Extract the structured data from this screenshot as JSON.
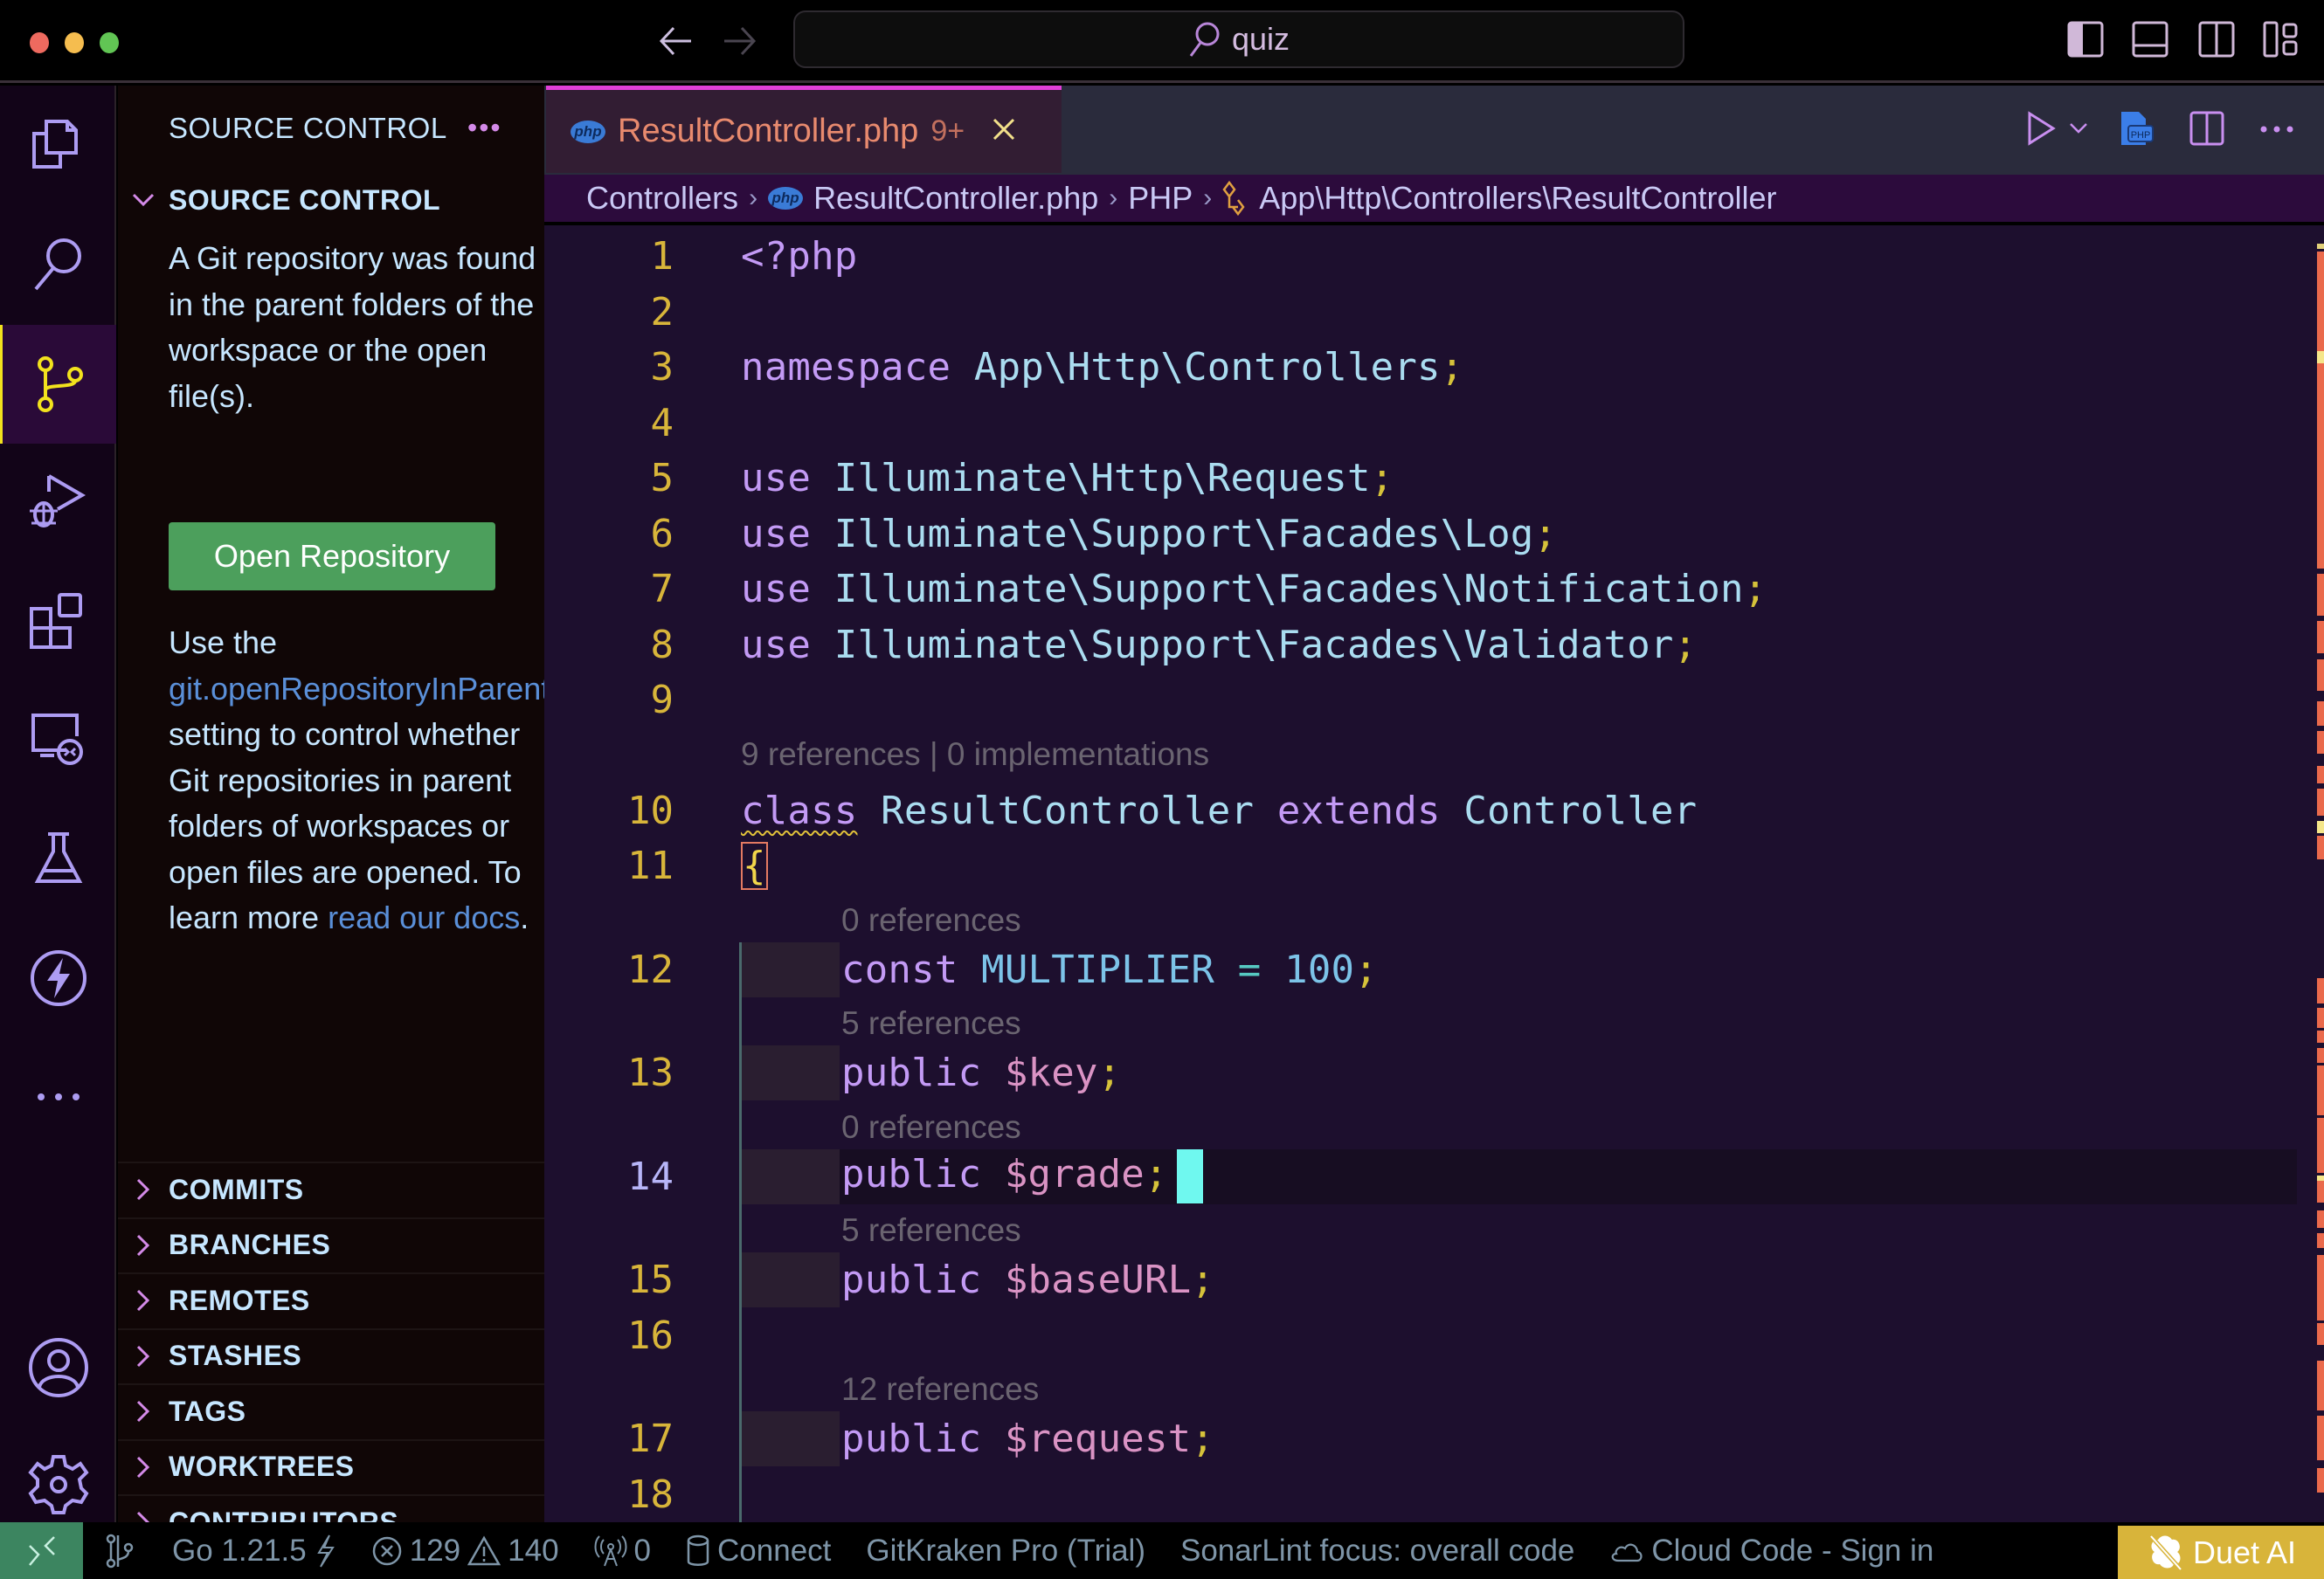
{
  "titlebar": {
    "search_text": "quiz",
    "traffic_lights": {
      "close": "#ee6a5f",
      "minimize": "#f5bd4f",
      "maximize": "#61c554"
    }
  },
  "activity_bar": {
    "items": [
      {
        "name": "explorer",
        "icon": "files-icon"
      },
      {
        "name": "search",
        "icon": "search-icon"
      },
      {
        "name": "source-control",
        "icon": "source-control-icon",
        "active": true
      },
      {
        "name": "run-debug",
        "icon": "run-debug-icon"
      },
      {
        "name": "extensions",
        "icon": "extensions-icon"
      },
      {
        "name": "remote-explorer",
        "icon": "remote-explorer-icon"
      },
      {
        "name": "testing",
        "icon": "flask-icon"
      },
      {
        "name": "thunder",
        "icon": "lightning-icon"
      },
      {
        "name": "more",
        "icon": "more-icon"
      }
    ],
    "bottom": [
      {
        "name": "accounts",
        "icon": "account-icon"
      },
      {
        "name": "manage",
        "icon": "gear-icon"
      }
    ]
  },
  "sidebar": {
    "title": "SOURCE CONTROL",
    "section_title": "SOURCE CONTROL",
    "message_1": "A Git repository was found in the parent folders of the workspace or the open file(s).",
    "open_repo_button": "Open Repository",
    "message_2_prefix": "Use the",
    "message_2_setting": "git.openRepositoryInParentFolders",
    "message_2_mid": "setting to control whether Git repositories in parent folders of workspaces or open files are opened. To learn more",
    "message_2_link": "read our docs",
    "message_2_suffix": ".",
    "sections": [
      "COMMITS",
      "BRANCHES",
      "REMOTES",
      "STASHES",
      "TAGS",
      "WORKTREES",
      "CONTRIBUTORS"
    ]
  },
  "editor": {
    "tab": {
      "filename": "ResultController.php",
      "problems_badge": "9+",
      "icon_label": "php"
    },
    "breadcrumbs": [
      "Controllers",
      "ResultController.php",
      "PHP",
      "App\\Http\\Controllers\\ResultController"
    ],
    "lines": [
      {
        "n": "1",
        "tokens": [
          {
            "t": "<?php",
            "c": "kw"
          }
        ]
      },
      {
        "n": "2",
        "tokens": []
      },
      {
        "n": "3",
        "tokens": [
          {
            "t": "namespace",
            "c": "kw"
          },
          {
            "t": " App\\Http\\Controllers",
            "c": "cls"
          },
          {
            "t": ";",
            "c": "semi"
          }
        ]
      },
      {
        "n": "4",
        "tokens": []
      },
      {
        "n": "5",
        "tokens": [
          {
            "t": "use",
            "c": "kw"
          },
          {
            "t": " Illuminate\\Http\\Request",
            "c": "cls"
          },
          {
            "t": ";",
            "c": "semi"
          }
        ]
      },
      {
        "n": "6",
        "tokens": [
          {
            "t": "use",
            "c": "kw"
          },
          {
            "t": " Illuminate\\Support\\Facades\\Log",
            "c": "cls"
          },
          {
            "t": ";",
            "c": "semi"
          }
        ]
      },
      {
        "n": "7",
        "tokens": [
          {
            "t": "use",
            "c": "kw"
          },
          {
            "t": " Illuminate\\Support\\Facades\\Notification",
            "c": "cls"
          },
          {
            "t": ";",
            "c": "semi"
          }
        ]
      },
      {
        "n": "8",
        "tokens": [
          {
            "t": "use",
            "c": "kw"
          },
          {
            "t": " Illuminate\\Support\\Facades\\Validator",
            "c": "cls"
          },
          {
            "t": ";",
            "c": "semi"
          }
        ]
      },
      {
        "n": "9",
        "tokens": []
      },
      {
        "n": "10",
        "lens": "9 references | 0 implementations",
        "tokens": [
          {
            "t": "class",
            "c": "kw squig"
          },
          {
            "t": " ResultController ",
            "c": "cls"
          },
          {
            "t": "extends",
            "c": "kw"
          },
          {
            "t": " Controller",
            "c": "cls"
          }
        ]
      },
      {
        "n": "11",
        "tokens": [
          {
            "t": "{",
            "c": "brace"
          }
        ]
      },
      {
        "n": "12",
        "lens": "0 references",
        "indent": true,
        "tokens": [
          {
            "t": "const",
            "c": "kw"
          },
          {
            "t": " MULTIPLIER ",
            "c": "const"
          },
          {
            "t": "=",
            "c": "op"
          },
          {
            "t": " 100",
            "c": "num"
          },
          {
            "t": ";",
            "c": "semi"
          }
        ]
      },
      {
        "n": "13",
        "lens": "5 references",
        "indent": true,
        "tokens": [
          {
            "t": "public",
            "c": "kw"
          },
          {
            "t": " $key",
            "c": "var"
          },
          {
            "t": ";",
            "c": "semi"
          }
        ]
      },
      {
        "n": "14",
        "lens": "0 references",
        "indent": true,
        "current": true,
        "tokens": [
          {
            "t": "public",
            "c": "kw"
          },
          {
            "t": " $grade",
            "c": "var"
          },
          {
            "t": ";",
            "c": "semi"
          }
        ]
      },
      {
        "n": "15",
        "lens": "5 references",
        "indent": true,
        "tokens": [
          {
            "t": "public",
            "c": "kw"
          },
          {
            "t": " $baseURL",
            "c": "var"
          },
          {
            "t": ";",
            "c": "semi"
          }
        ]
      },
      {
        "n": "16",
        "tokens": []
      },
      {
        "n": "17",
        "lens": "12 references",
        "indent": true,
        "tokens": [
          {
            "t": "public",
            "c": "kw"
          },
          {
            "t": " $request",
            "c": "var"
          },
          {
            "t": ";",
            "c": "semi"
          }
        ]
      },
      {
        "n": "18",
        "tokens": []
      }
    ]
  },
  "statusbar": {
    "go_version": "Go 1.21.5",
    "errors": "129",
    "warnings": "140",
    "ports": "0",
    "connect": "Connect",
    "gitkraken": "GitKraken Pro (Trial)",
    "sonarlint": "SonarLint focus: overall code",
    "cloud_code": "Cloud Code - Sign in",
    "duet_ai": "Duet AI"
  },
  "colors": {
    "accent_tab_border": "#e23fd9",
    "open_repo_button": "#4c9f5c",
    "duet_ai_bg": "#d8b43a",
    "remote_bg": "#3c8560",
    "cursor": "#6ff8ef"
  }
}
